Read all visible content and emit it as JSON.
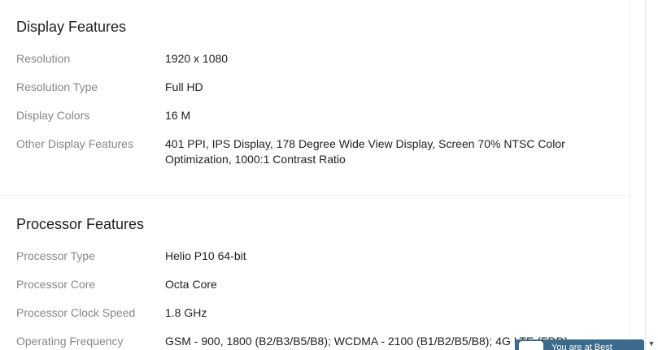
{
  "sections": [
    {
      "title": "Display Features",
      "rows": [
        {
          "label": "Resolution",
          "value": "1920 x 1080"
        },
        {
          "label": "Resolution Type",
          "value": "Full HD"
        },
        {
          "label": "Display Colors",
          "value": "16 M"
        },
        {
          "label": "Other Display Features",
          "value": "401 PPI, IPS Display, 178 Degree Wide View Display, Screen 70% NTSC Color Optimization, 1000:1 Contrast Ratio"
        }
      ]
    },
    {
      "title": "Processor Features",
      "rows": [
        {
          "label": "Processor Type",
          "value": "Helio P10 64-bit"
        },
        {
          "label": "Processor Core",
          "value": "Octa Core"
        },
        {
          "label": "Processor Clock Speed",
          "value": "1.8 GHz"
        },
        {
          "label": "Operating Frequency",
          "value": "GSM - 900, 1800 (B2/B3/B5/B8); WCDMA - 2100 (B1/B2/B5/B8); 4G LTE (FDD)"
        }
      ]
    }
  ],
  "notice": {
    "text": "You are at Best"
  },
  "icons": {
    "scroll_down": "chevron-down-icon",
    "notice": "chat-icon"
  }
}
